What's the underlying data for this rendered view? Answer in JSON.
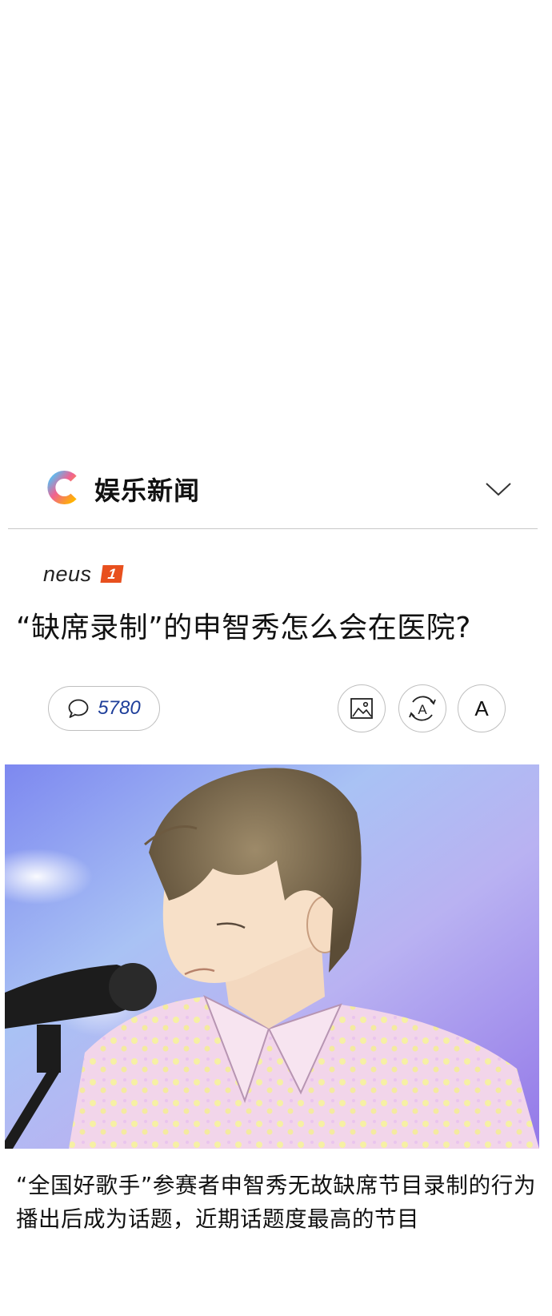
{
  "header": {
    "section_title": "娱乐新闻",
    "logo": "c-brand-logo",
    "chevron": "chevron-down-icon"
  },
  "article": {
    "source": "neus",
    "source_badge": "1",
    "headline": "“缺席录制”的申智秀怎么会在医院?",
    "comment_count": "5780",
    "font_button_label": "A",
    "caption": "“全国好歌手”参赛者申智秀无故缺席节目录制的行为播出后成为话题，近期话题度最高的节目"
  },
  "colors": {
    "badge": "#e8501e",
    "comment_count": "#1f3f9a",
    "divider": "#c8c8c8"
  },
  "icons": [
    "c-brand-logo",
    "chevron-down-icon",
    "comment-icon",
    "image-icon",
    "translate-icon"
  ]
}
